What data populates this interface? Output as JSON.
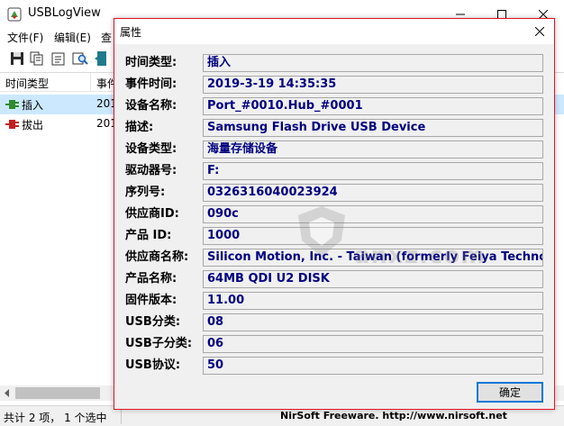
{
  "window": {
    "title": "USBLogView"
  },
  "menu": [
    "文件(F)",
    "编辑(E)",
    "查"
  ],
  "toolbar_icons": [
    "save-icon",
    "copy-icon",
    "properties-icon",
    "search-icon",
    "exit-icon"
  ],
  "list": {
    "columns": [
      "时间类型",
      "事件"
    ],
    "rows": [
      {
        "icon": "usb-plug-green-icon",
        "type": "插入",
        "time": "201"
      },
      {
        "icon": "usb-plug-red-icon",
        "type": "拔出",
        "time": "201"
      }
    ]
  },
  "status": {
    "count": "共计 2 项， 1 个选中",
    "credit": "NirSoft Freeware.  http://www.nirsoft.net"
  },
  "dialog": {
    "title": "属性",
    "ok_label": "确定",
    "properties": [
      {
        "label": "时间类型:",
        "value": "插入"
      },
      {
        "label": "事件时间:",
        "value": "2019-3-19 14:35:35"
      },
      {
        "label": "设备名称:",
        "value": "Port_#0010.Hub_#0001"
      },
      {
        "label": "描述:",
        "value": "Samsung Flash Drive USB Device"
      },
      {
        "label": "设备类型:",
        "value": "海量存储设备"
      },
      {
        "label": "驱动器号:",
        "value": "F:"
      },
      {
        "label": "序列号:",
        "value": "0326316040023924"
      },
      {
        "label": "供应商ID:",
        "value": "090c"
      },
      {
        "label": "产品 ID:",
        "value": "1000"
      },
      {
        "label": "供应商名称:",
        "value": "Silicon Motion, Inc. - Taiwan (formerly Feiya Technology C"
      },
      {
        "label": "产品名称:",
        "value": "64MB QDI U2 DISK"
      },
      {
        "label": "固件版本:",
        "value": "11.00"
      },
      {
        "label": "USB分类:",
        "value": "08"
      },
      {
        "label": "USB子分类:",
        "value": "06"
      },
      {
        "label": "USB协议:",
        "value": "50"
      }
    ]
  },
  "watermark": {
    "text": "anxz.com"
  },
  "colors": {
    "accent_border": "#e81123",
    "field_text": "#000080",
    "button_focus": "#0078d7"
  }
}
